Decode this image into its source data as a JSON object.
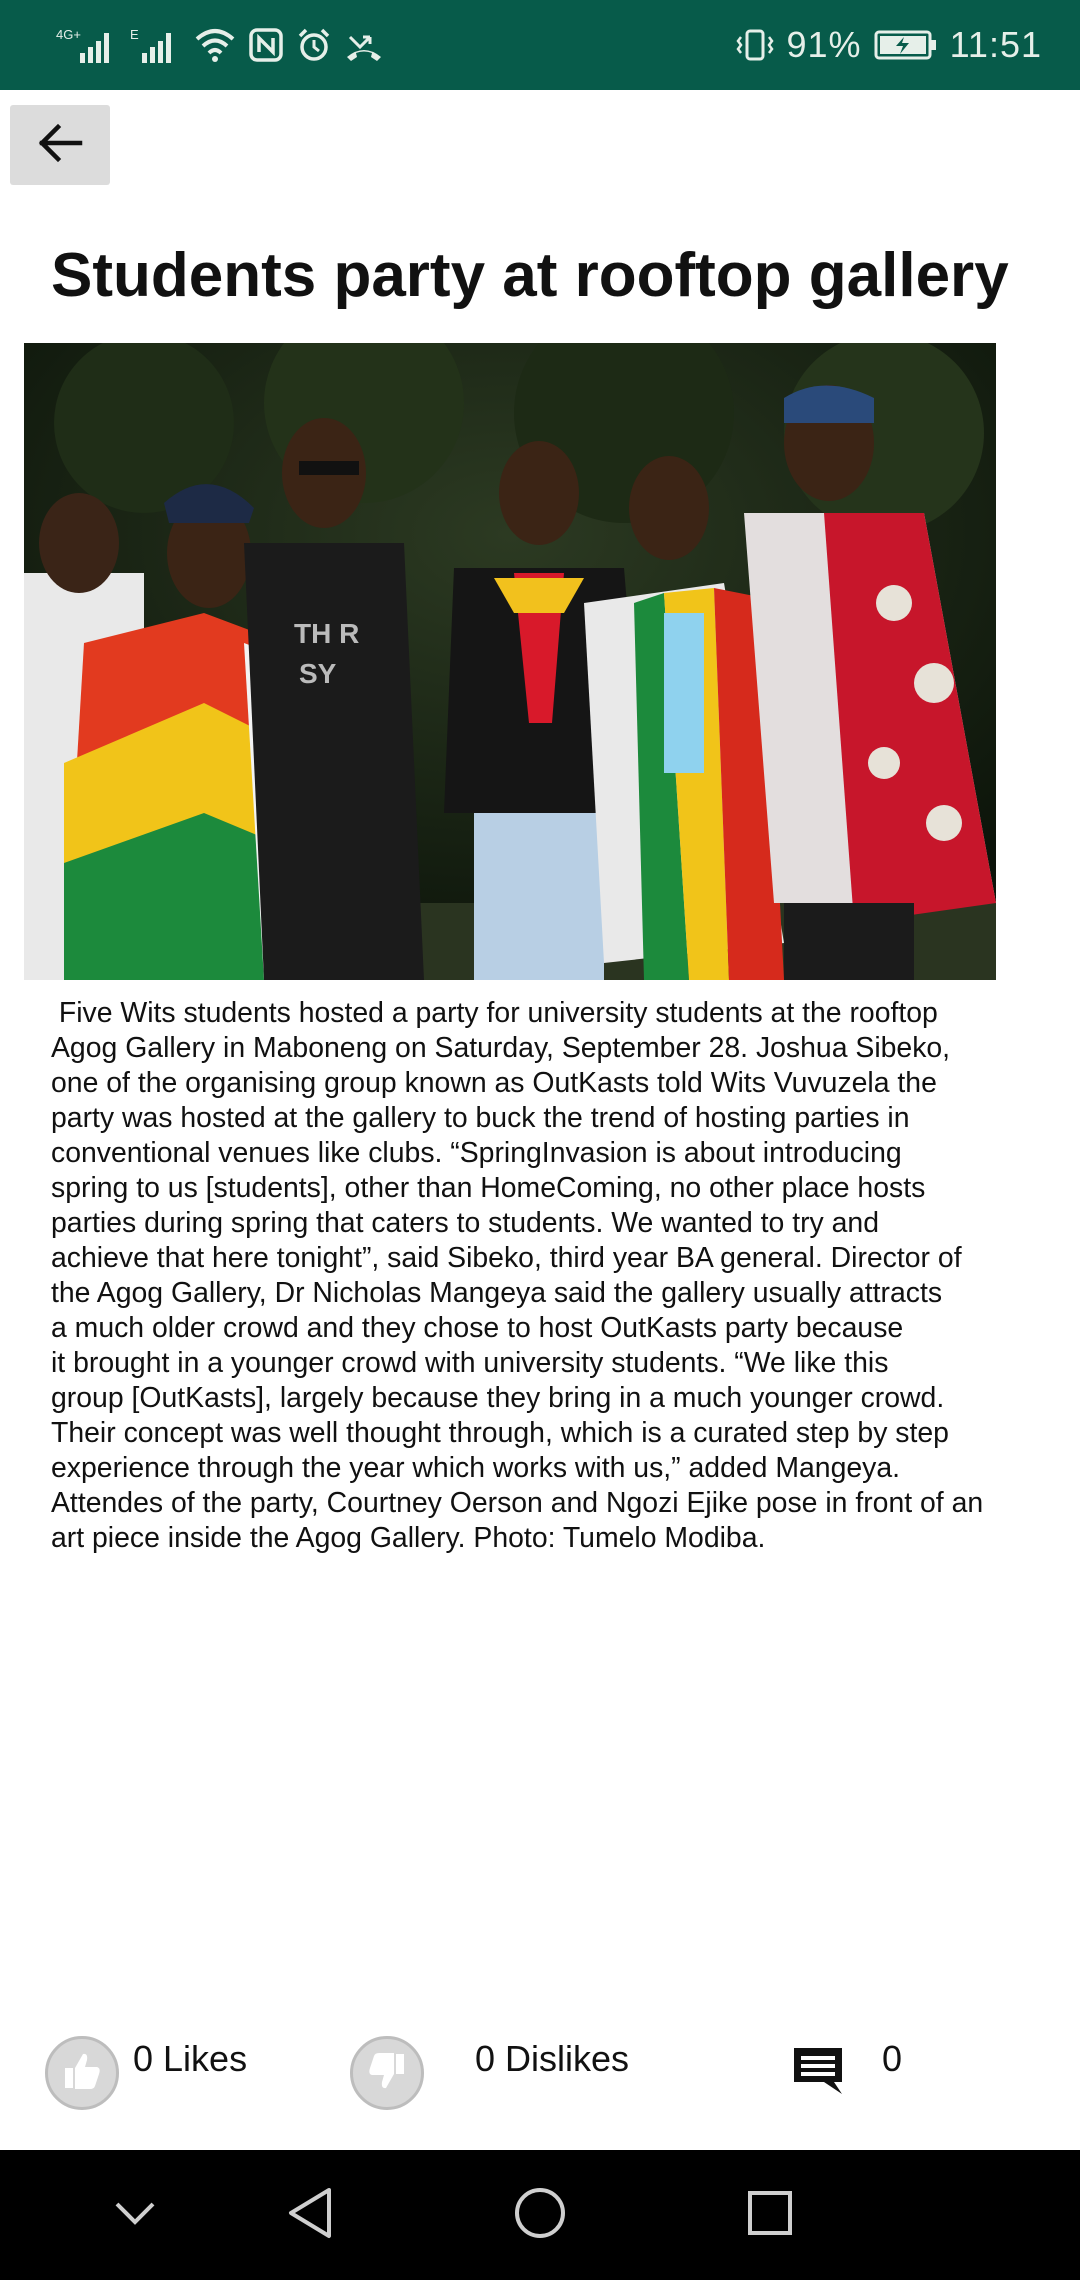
{
  "status_bar": {
    "network_left": "4G+",
    "network_right": "E",
    "battery_percent": "91%",
    "time": "11:51",
    "icons": [
      "signal-4g-icon",
      "signal-e-icon",
      "wifi-icon",
      "nfc-icon",
      "alarm-icon",
      "missed-call-icon",
      "vibrate-icon",
      "battery-charging-icon"
    ]
  },
  "toolbar": {
    "back_icon": "arrow-left-icon"
  },
  "article": {
    "title": "Students party at rooftop gallery",
    "image_icon": "article-photo",
    "body": " Five Wits students hosted a party for university students at the rooftop\nAgog Gallery in Maboneng on Saturday, September 28. Joshua Sibeko,\none of the organising group known as OutKasts told Wits Vuvuzela the\nparty was hosted at the gallery to buck the trend of hosting parties in\nconventional venues like clubs. “SpringInvasion is about introducing\nspring to us [students], other than HomeComing, no other place hosts\nparties during spring that caters to students. We wanted to try and\nachieve that here tonight”, said Sibeko, third year BA general. Director of\nthe Agog Gallery, Dr Nicholas Mangeya said the gallery usually attracts\na much older crowd and they chose to host OutKasts party because\nit brought in a younger crowd with university students. “We like this\ngroup [OutKasts], largely because they bring in a much younger crowd.\nTheir concept was well thought through, which is a curated step by step\nexperience through the year which works with us,” added Mangeya.\nAttendes of the party, Courtney Oerson and Ngozi Ejike pose in front of an\nart piece inside the Agog Gallery. Photo: Tumelo Modiba."
  },
  "reactions": {
    "likes_label": "0 Likes",
    "dislikes_label": "0 Dislikes",
    "comments_count": "0",
    "like_icon": "thumbs-up-icon",
    "dislike_icon": "thumbs-down-icon",
    "comment_icon": "comment-icon"
  },
  "nav_bar": {
    "icons": [
      "chevron-down-icon",
      "back-triangle-icon",
      "home-circle-icon",
      "recents-square-icon"
    ]
  },
  "colors": {
    "status_bar_bg": "#075b4a",
    "nav_bar_bg": "#000000",
    "back_button_bg": "#dcdcdc"
  }
}
